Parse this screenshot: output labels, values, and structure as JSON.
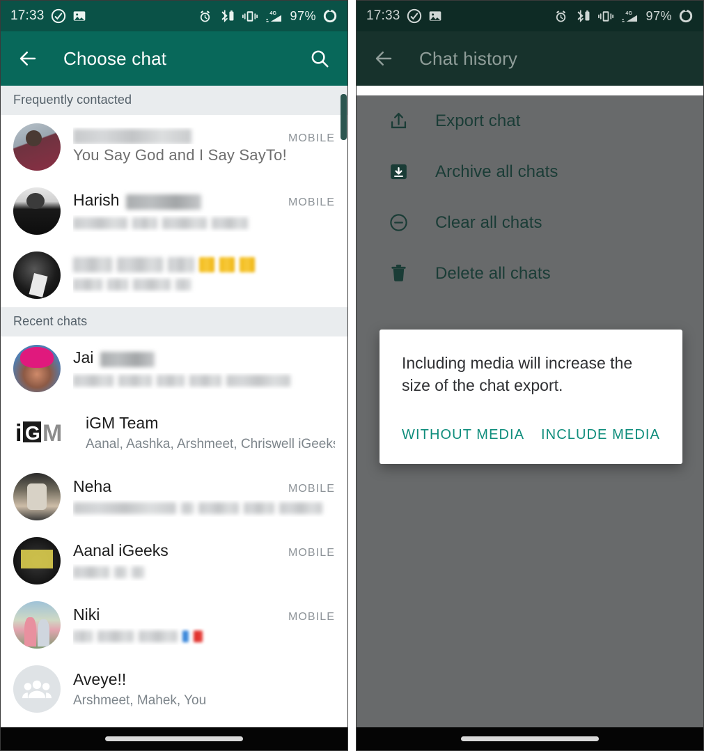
{
  "left_phone": {
    "status_bar": {
      "time": "17:33",
      "battery_pct": "97%",
      "icons_left": [
        "cloud-sync-icon",
        "photo-icon"
      ],
      "icons_right": [
        "alarm-icon",
        "bluetooth-battery-icon",
        "vibrate-icon",
        "signal-4g-icon",
        "battery-icon"
      ]
    },
    "app_bar": {
      "back_icon": "back-arrow-icon",
      "title": "Choose chat",
      "search_icon": "search-icon"
    },
    "sections": [
      {
        "header": "Frequently contacted",
        "rows": [
          {
            "name": "",
            "name_redacted": true,
            "tag": "MOBILE",
            "sub": "You Say God and I Say SayTo!",
            "sub_ghost": true,
            "avatar": "av1"
          },
          {
            "name": "Harish",
            "name_redacted": true,
            "tag": "MOBILE",
            "sub": "",
            "sub_redacted": true,
            "avatar": "av2"
          },
          {
            "name": "",
            "name_redacted": true,
            "tag": "",
            "sub": "",
            "sub_redacted": true,
            "avatar": "av3",
            "has_yellow": true
          }
        ]
      },
      {
        "header": "Recent chats",
        "rows": [
          {
            "name": "Jai",
            "name_redacted": true,
            "tag": "",
            "sub": "",
            "sub_redacted": true,
            "avatar": "av4"
          },
          {
            "name": "iGM Team",
            "name_redacted": false,
            "tag": "",
            "sub": "Aanal, Aashka, Arshmeet, Chriswell iGeeks...",
            "avatar": "igm"
          },
          {
            "name": "Neha",
            "name_redacted": false,
            "tag": "MOBILE",
            "sub": "",
            "sub_redacted": true,
            "avatar": "av5"
          },
          {
            "name": "Aanal iGeeks",
            "name_redacted": false,
            "tag": "MOBILE",
            "sub": "",
            "sub_redacted": true,
            "avatar": "av6"
          },
          {
            "name": "Niki",
            "name_redacted": false,
            "tag": "MOBILE",
            "sub": "",
            "sub_redacted": true,
            "avatar": "av7",
            "has_blue_red": true
          },
          {
            "name": "Aveye!!",
            "name_redacted": false,
            "tag": "",
            "sub": "Arshmeet, Mahek, You",
            "avatar": "group"
          }
        ]
      }
    ],
    "scrollbar": {
      "visible": true
    }
  },
  "right_phone": {
    "status_bar": {
      "time": "17:33",
      "battery_pct": "97%",
      "icons_left": [
        "cloud-sync-icon",
        "photo-icon"
      ],
      "icons_right": [
        "alarm-icon",
        "bluetooth-battery-icon",
        "vibrate-icon",
        "signal-4g-icon",
        "battery-icon"
      ]
    },
    "app_bar": {
      "back_icon": "back-arrow-icon",
      "title": "Chat history"
    },
    "menu_items": [
      {
        "label": "Export chat",
        "icon": "export-upload-icon"
      },
      {
        "label": "Archive all chats",
        "icon": "archive-box-icon"
      },
      {
        "label": "Clear all chats",
        "icon": "minus-circle-icon"
      },
      {
        "label": "Delete all chats",
        "icon": "trash-icon"
      }
    ],
    "dialog": {
      "message": "Including media will increase the size of the chat export.",
      "buttons": [
        {
          "label": "WITHOUT MEDIA"
        },
        {
          "label": "INCLUDE MEDIA"
        }
      ]
    }
  },
  "colors": {
    "status_bar_green": "#0a5247",
    "app_bar_green": "#08685a",
    "section_header_bg": "#e9ecee",
    "scrim": "#686a6b",
    "accent_teal": "#0f8d7c",
    "menu_label": "#1a3c36",
    "nav_bar": "#050505"
  }
}
